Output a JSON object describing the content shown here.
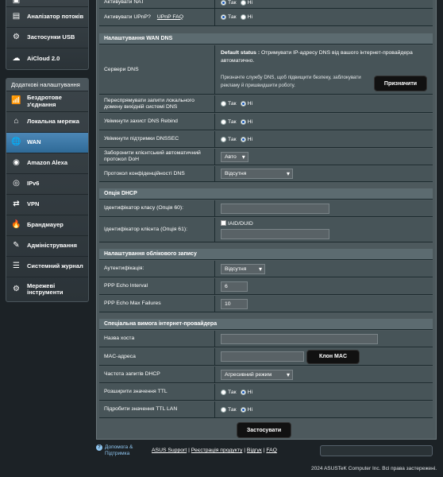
{
  "sidebar": {
    "top_items": [
      {
        "label": "",
        "icon": "box-icon"
      },
      {
        "label": "Аналізатор потоків",
        "icon": "analyzer-icon"
      },
      {
        "label": "Застосунки USB",
        "icon": "usb-apps-icon"
      },
      {
        "label": "AiCloud 2.0",
        "icon": "cloud-icon"
      }
    ],
    "advanced_header": "Додаткові налаштування",
    "advanced_items": [
      {
        "label": "Бездротове з'єднання",
        "icon": "wireless-icon"
      },
      {
        "label": "Локальна мережа",
        "icon": "lan-icon"
      },
      {
        "label": "WAN",
        "icon": "globe-icon"
      },
      {
        "label": "Amazon Alexa",
        "icon": "alexa-icon"
      },
      {
        "label": "IPv6",
        "icon": "ipv6-icon"
      },
      {
        "label": "VPN",
        "icon": "vpn-icon"
      },
      {
        "label": "Брандмауер",
        "icon": "firewall-icon"
      },
      {
        "label": "Адміністрування",
        "icon": "admin-icon"
      },
      {
        "label": "Системний журнал",
        "icon": "syslog-icon"
      },
      {
        "label": "Мережеві інструменти",
        "icon": "network-tools-icon"
      }
    ]
  },
  "top_rows": {
    "nat_label": "Активувати NAT",
    "upnp_label": "Активувати UPnP?",
    "upnp_faq": "UPnP  FAQ",
    "yes": "Так",
    "no": "Ні"
  },
  "wan_dns": {
    "header": "Налаштування WAN DNS",
    "servers_label": "Сервери DNS",
    "default_status_key": "Default status :",
    "default_status_text": " Отримувати IP-адресу DNS від вашого інтернет-провайдера автоматично.",
    "assign_hint": "Призначте службу DNS, щоб підвищити безпеку, заблокувати рекламу й пришвидшити роботу.",
    "assign_button": "Призначити",
    "forward_label": "Переспрямувати запити локального домену вихідній системі DNS",
    "rebind_label": "Увімкнути захист DNS Rebind",
    "dnssec_label": "Увімкнути підтримки DNSSEC",
    "doh_label": "Заборонити клієнтський автоматичний протокол DoH",
    "doh_value": "Авто",
    "privacy_label": "Протокол конфіденційності DNS",
    "privacy_value": "Відсутня"
  },
  "dhcp": {
    "header": "Опція DHCP",
    "class_label": "Ідентифікатор класу (Опція 60):",
    "client_label": "Ідентифікатор клієнта (Опція 61):",
    "iaid_label": "IAID/DUID"
  },
  "account": {
    "header": "Налаштування облікового запису",
    "auth_label": "Аутентифікація:",
    "auth_value": "Відсутня",
    "echo_interval_label": "PPP Echo Interval",
    "echo_interval_value": "6",
    "echo_failures_label": "PPP Echo Max Failures",
    "echo_failures_value": "10"
  },
  "isp": {
    "header": "Спеціальна вимога інтернет-провайдера",
    "host_label": "Назва хоста",
    "mac_label": "MAC-адреса",
    "clone_button": "Клон MAC",
    "dhcp_freq_label": "Частота запитів DHCP",
    "dhcp_freq_value": "Агресивний режим",
    "ttl_ext_label": "Розширити значення TTL",
    "ttl_spoof_label": "Підробити значення TTL LAN"
  },
  "apply_button": "Застосувати",
  "footer": {
    "help": "Допомога & Підтримка",
    "asus_support": "ASUS Support",
    "register": "Реєстрація продукту",
    "feedback": "Відгук",
    "faq": "FAQ",
    "sep": " | ",
    "copyright": "2024 ASUSTeK Computer Inc. Всі права застережені."
  }
}
